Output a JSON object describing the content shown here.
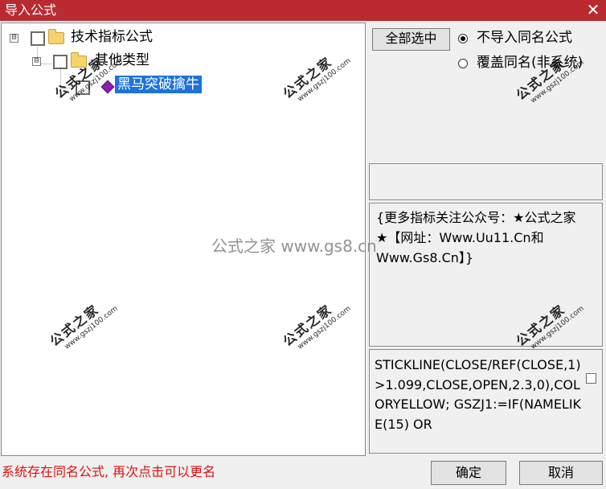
{
  "window": {
    "title": "导入公式",
    "close_glyph": "✕"
  },
  "tree": {
    "root_label": "技术指标公式",
    "group_label": "其他类型",
    "formula_label": "黑马突破擒牛",
    "expander_glyph": "⊟",
    "formula_icon": "diamond-gem-icon"
  },
  "options": {
    "select_all_label": "全部选中",
    "radio_skip_label": "不导入同名公式",
    "radio_overwrite_label": "覆盖同名(非系统)",
    "selected_option": "radio_skip"
  },
  "description": "{更多指标关注公众号：★公式之家★【网址：Www.Uu11.Cn和Www.Gs8.Cn】}",
  "code_preview": "STICKLINE(CLOSE/REF(CLOSE,1)>1.099,CLOSE,OPEN,2.3,0),COLORYELLOW;\nGSZJ1:=IF(NAMELIKE(15) OR",
  "status_message": "系统存在同名公式, 再次点击可以更名",
  "footer": {
    "ok_label": "确定",
    "cancel_label": "取消"
  },
  "watermark": {
    "cn": "公式之家",
    "url": "www.gszj100.com",
    "center": "公式之家 www.gs8.cn"
  },
  "colors": {
    "titlebar": "#b92a31",
    "selection": "#1e73d8",
    "status_text": "#e01010"
  }
}
